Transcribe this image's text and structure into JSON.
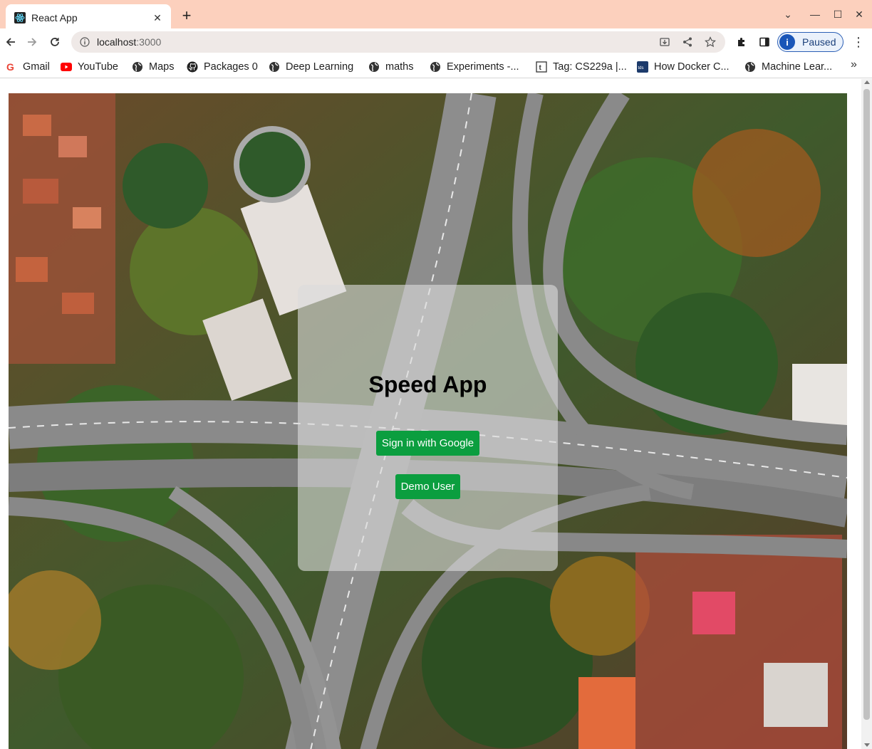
{
  "browser": {
    "tab_title": "React App",
    "url_host": "localhost",
    "url_port": ":3000",
    "profile_initial": "i",
    "profile_status": "Paused"
  },
  "bookmarks": [
    {
      "label": "Gmail",
      "icon": "gmail-icon"
    },
    {
      "label": "YouTube",
      "icon": "youtube-icon"
    },
    {
      "label": "Maps",
      "icon": "globe-icon"
    },
    {
      "label": "Packages 0",
      "icon": "github-icon"
    },
    {
      "label": "Deep Learning",
      "icon": "globe-icon"
    },
    {
      "label": "maths",
      "icon": "globe-icon"
    },
    {
      "label": "Experiments -...",
      "icon": "globe-icon"
    },
    {
      "label": "Tag: CS229a |...",
      "icon": "page-icon"
    },
    {
      "label": "How Docker C...",
      "icon": "site-icon"
    },
    {
      "label": "Machine Lear...",
      "icon": "globe-icon"
    }
  ],
  "page": {
    "title": "Speed App",
    "google_button": "Sign in with Google",
    "demo_button": "Demo User"
  },
  "colors": {
    "tabstrip": "#fcd0bd",
    "button_green": "#0b9e3f",
    "card_overlay": "rgba(220,220,220,0.62)"
  }
}
